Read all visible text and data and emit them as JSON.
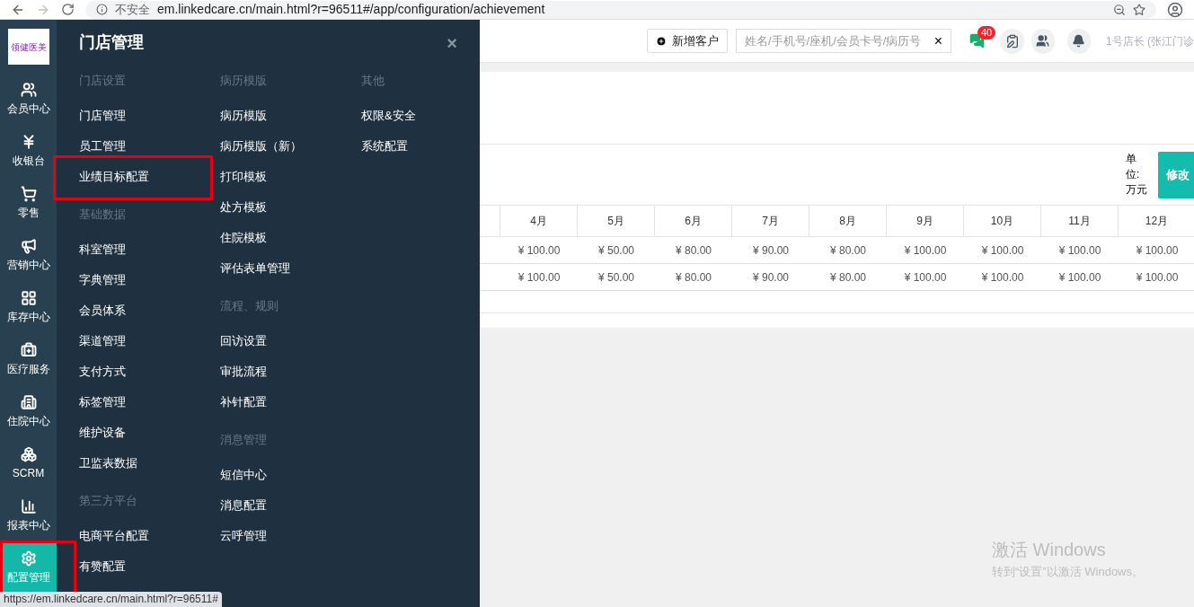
{
  "browser": {
    "security": "不安全",
    "url": "em.linkedcare.cn/main.html?r=96511#/app/configuration/achievement"
  },
  "sidebar": {
    "logo": "领健医美",
    "items": [
      {
        "kind": "users",
        "label": "会员中心",
        "selected": false,
        "outlined": false
      },
      {
        "kind": "yen",
        "label": "收银台",
        "selected": false,
        "outlined": false
      },
      {
        "kind": "cart",
        "label": "零售",
        "selected": false,
        "outlined": false
      },
      {
        "kind": "megaphone",
        "label": "营销中心",
        "selected": false,
        "outlined": false
      },
      {
        "kind": "grid",
        "label": "库存中心",
        "selected": false,
        "outlined": false
      },
      {
        "kind": "medkit",
        "label": "医疗服务",
        "selected": false,
        "outlined": false
      },
      {
        "kind": "building",
        "label": "住院中心",
        "selected": false,
        "outlined": false
      },
      {
        "kind": "boxes",
        "label": "SCRM",
        "selected": false,
        "outlined": false
      },
      {
        "kind": "chart",
        "label": "报表中心",
        "selected": false,
        "outlined": false
      },
      {
        "kind": "gear",
        "label": "配置管理",
        "selected": true,
        "outlined": true
      }
    ]
  },
  "menu": {
    "title": "门店管理",
    "close": "×",
    "columns": [
      [
        {
          "heading": "门店设置",
          "items": [
            {
              "label": "门店管理",
              "outlined": false
            },
            {
              "label": "员工管理",
              "outlined": false
            },
            {
              "label": "业绩目标配置",
              "outlined": true
            }
          ]
        },
        {
          "heading": "基础数据",
          "items": [
            {
              "label": "科室管理",
              "outlined": false
            },
            {
              "label": "字典管理",
              "outlined": false
            },
            {
              "label": "会员体系",
              "outlined": false
            },
            {
              "label": "渠道管理",
              "outlined": false
            },
            {
              "label": "支付方式",
              "outlined": false
            },
            {
              "label": "标签管理",
              "outlined": false
            },
            {
              "label": "维护设备",
              "outlined": false
            },
            {
              "label": "卫监表数据",
              "outlined": false
            }
          ]
        },
        {
          "heading": "第三方平台",
          "items": [
            {
              "label": "电商平台配置",
              "outlined": false
            },
            {
              "label": "有赞配置",
              "outlined": false
            }
          ]
        }
      ],
      [
        {
          "heading": "病历模版",
          "items": [
            {
              "label": "病历模版",
              "outlined": false
            },
            {
              "label": "病历模版（新）",
              "outlined": false
            },
            {
              "label": "打印模板",
              "outlined": false
            },
            {
              "label": "处方模板",
              "outlined": false
            },
            {
              "label": "住院模板",
              "outlined": false
            },
            {
              "label": "评估表单管理",
              "outlined": false
            }
          ]
        },
        {
          "heading": "流程、规则",
          "items": [
            {
              "label": "回访设置",
              "outlined": false
            },
            {
              "label": "审批流程",
              "outlined": false
            },
            {
              "label": "补针配置",
              "outlined": false
            }
          ]
        },
        {
          "heading": "消息管理",
          "items": [
            {
              "label": "短信中心",
              "outlined": false
            },
            {
              "label": "消息配置",
              "outlined": false
            },
            {
              "label": "云呼管理",
              "outlined": false
            }
          ]
        }
      ],
      [
        {
          "heading": "其他",
          "items": [
            {
              "label": "权限&安全",
              "outlined": false
            },
            {
              "label": "系统配置",
              "outlined": false
            }
          ]
        }
      ]
    ]
  },
  "header": {
    "add_button": "新增客户",
    "search": {
      "placeholder": "姓名/手机号/座机/会员卡号/病历号",
      "clear": "×"
    },
    "message_count": "40",
    "user": "1号店长 (张江门诊"
  },
  "toolbar": {
    "unit": "单位:万元",
    "edit_button": "修改"
  },
  "table": {
    "columns": [
      "4月",
      "5月",
      "6月",
      "7月",
      "8月",
      "9月",
      "10月",
      "11月",
      "12月"
    ],
    "rows": [
      [
        "¥ 100.00",
        "¥ 50.00",
        "¥ 80.00",
        "¥ 90.00",
        "¥ 80.00",
        "¥ 100.00",
        "¥ 100.00",
        "¥ 100.00",
        "¥ 100.00"
      ],
      [
        "¥ 100.00",
        "¥ 50.00",
        "¥ 80.00",
        "¥ 90.00",
        "¥ 80.00",
        "¥ 100.00",
        "¥ 100.00",
        "¥ 100.00",
        "¥ 100.00"
      ]
    ]
  },
  "status_link": "https://em.linkedcare.cn/main.html?r=96511#",
  "os_notice": {
    "title": "激活 Windows",
    "text": "转到“设置”以激活 Windows。"
  }
}
